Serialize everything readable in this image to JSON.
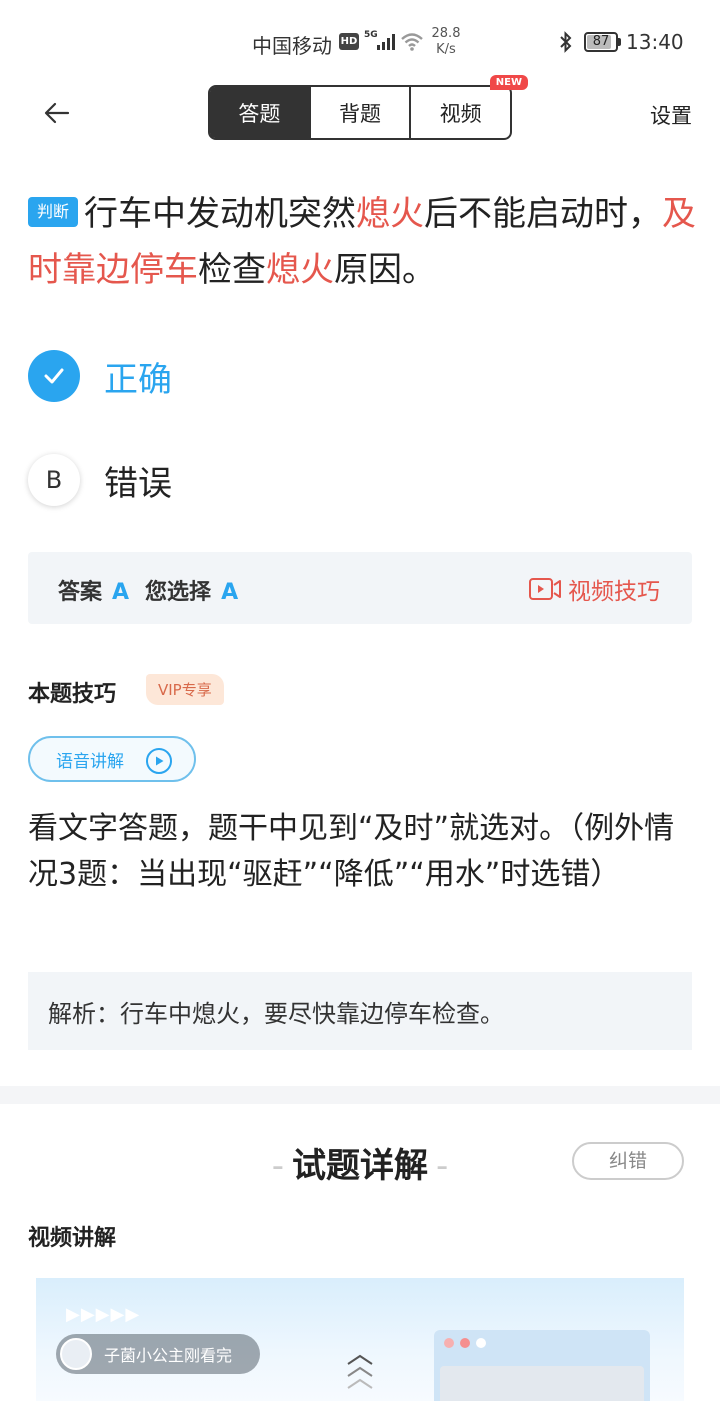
{
  "status_bar": {
    "carrier": "中国移动",
    "hd": "HD",
    "network": "5G",
    "speed_value": "28.8",
    "speed_unit": "K/s",
    "battery": "87",
    "battery_level": 0.87,
    "time": "13:40"
  },
  "nav": {
    "tabs": [
      {
        "label": "答题",
        "active": true
      },
      {
        "label": "背题",
        "active": false
      },
      {
        "label": "视频",
        "active": false
      }
    ],
    "new_badge": "NEW",
    "settings": "设置"
  },
  "question": {
    "tag": "判断",
    "segments": [
      {
        "text": "行车中发动机突然",
        "highlight": false
      },
      {
        "text": "熄火",
        "highlight": true
      },
      {
        "text": "后不能启动时，",
        "highlight": false
      },
      {
        "text": "及时靠边停车",
        "highlight": true
      },
      {
        "text": "检查",
        "highlight": false
      },
      {
        "text": "熄火",
        "highlight": true
      },
      {
        "text": "原因。",
        "highlight": false
      }
    ]
  },
  "options": [
    {
      "letter": "A",
      "label": "正确",
      "selected": true
    },
    {
      "letter": "B",
      "label": "错误",
      "selected": false
    }
  ],
  "answer_bar": {
    "answer_label": "答案",
    "answer_value": "A",
    "choice_label": "您选择",
    "choice_value": "A",
    "video_tip": "视频技巧"
  },
  "skill": {
    "title": "本题技巧",
    "vip": "VIP专享",
    "voice_button": "语音讲解",
    "text": "看文字答题，题干中见到“及时”就选对。（例外情况3题：当出现“驱赶”“降低”“用水”时选错）"
  },
  "analysis": "解析：行车中熄火，要尽快靠边停车检查。",
  "detail": {
    "title": "试题详解",
    "report_button": "纠错",
    "video_section": "视频讲解",
    "viewer_text": "子菌小公主刚看完",
    "arrows": "▶▶▶▶▶"
  },
  "colors": {
    "accent_blue": "#2aa5ef",
    "highlight_red": "#e5574d",
    "new_badge_red": "#f04848",
    "panel_bg": "#f2f5f8"
  }
}
